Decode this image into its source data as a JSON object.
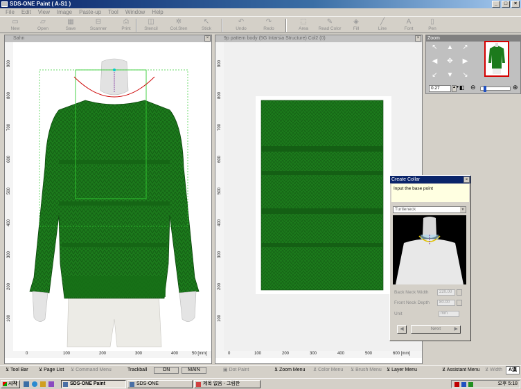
{
  "window": {
    "title": "SDS-ONE Paint ( A-S1 )"
  },
  "menu": [
    "File",
    "Edit",
    "View",
    "Image",
    "Paste-up",
    "Tool",
    "Window",
    "Help"
  ],
  "toolbar": [
    {
      "label": "New",
      "icon": "new-icon",
      "glyph": "▭"
    },
    {
      "label": "Open",
      "icon": "open-icon",
      "glyph": "▱"
    },
    {
      "label": "Save",
      "icon": "save-icon",
      "glyph": "▦"
    },
    {
      "label": "Scanner",
      "icon": "scanner-icon",
      "glyph": "⊟"
    },
    {
      "label": "Print",
      "icon": "print-icon",
      "glyph": "⎙"
    },
    {
      "label": "Stencil",
      "icon": "stencil-icon",
      "glyph": "◫"
    },
    {
      "label": "Col.Sten",
      "icon": "color-stencil-icon",
      "glyph": "✲"
    },
    {
      "label": "Stick",
      "icon": "stick-icon",
      "glyph": "↖"
    },
    {
      "label": "Undo",
      "icon": "undo-icon",
      "glyph": "↶"
    },
    {
      "label": "Redo",
      "icon": "redo-icon",
      "glyph": "↷"
    },
    {
      "label": "Area",
      "icon": "area-icon",
      "glyph": "⬚"
    },
    {
      "label": "Read Color",
      "icon": "eyedropper-icon",
      "glyph": "✎"
    },
    {
      "label": "Fill",
      "icon": "fill-icon",
      "glyph": "◈"
    },
    {
      "label": "Line",
      "icon": "line-icon",
      "glyph": "╱"
    },
    {
      "label": "Font",
      "icon": "font-icon",
      "glyph": "A"
    },
    {
      "label": "Pen",
      "icon": "pen-icon",
      "glyph": "▯"
    }
  ],
  "sweater_window": {
    "title": "Sahn",
    "vruler": [
      "900",
      "800",
      "700",
      "600",
      "500",
      "400",
      "300",
      "200",
      "100"
    ],
    "hruler": [
      "0",
      "100",
      "200",
      "300",
      "400",
      "50 [mm]"
    ]
  },
  "pattern_window": {
    "title": "9p pattern body (5G Intarsia Structure) Col2 (0)",
    "vruler": [
      "900",
      "800",
      "700",
      "600",
      "500",
      "400",
      "300",
      "200",
      "100"
    ],
    "hruler": [
      "0",
      "100",
      "200",
      "300",
      "400",
      "500",
      "600 [mm]"
    ]
  },
  "zoom_panel": {
    "title": "Zoom",
    "value": "0.27"
  },
  "create_collar": {
    "title": "Create Collar",
    "prompt": "Input the base point",
    "type": "Turtleneck",
    "back_neck_width_label": "Back Neck Width",
    "back_neck_width": "220.00",
    "front_neck_depth_label": "Front Neck Depth",
    "front_neck_depth": "80.00",
    "unit_label": "Unit",
    "unit": "mm",
    "next_label": "Next"
  },
  "bottom_bar": {
    "tool_bar": "Tool Bar",
    "page_list": "Page List",
    "command_menu": "Command Menu",
    "trackball": "Trackball",
    "on": "ON",
    "main": "MAIN",
    "dot_paint": "Dot Paint",
    "zoom_menu": "Zoom Menu",
    "color_menu": "Color Menu",
    "brush_menu": "Brush Menu",
    "layer_menu": "Layer Menu",
    "assistant_menu": "Assistant Menu",
    "width": "Width",
    "lang": "A漢"
  },
  "taskbar": {
    "start": "시작",
    "tasks": [
      "SDS-ONE Paint",
      "SDS-ONE",
      "제목 없음 - 그림판"
    ],
    "clock": "오후 5:18"
  },
  "colors": {
    "title_active": "#0a246a",
    "sweater_green": "#1c7a1c",
    "stitch_dark": "#125a12",
    "guide_green": "#33cc33",
    "collar_red": "#cc0000"
  }
}
